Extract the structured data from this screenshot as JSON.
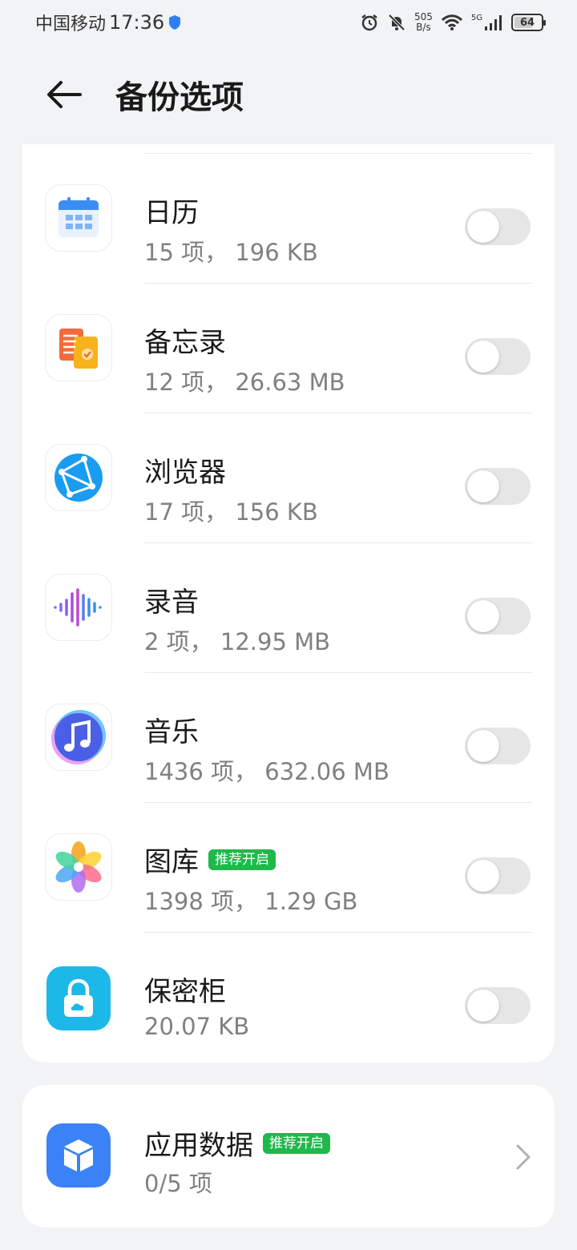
{
  "status_bar": {
    "carrier": "中国移动",
    "time": "17:36",
    "net_speed_value": "505",
    "net_speed_unit": "B/s",
    "network_type": "5G",
    "battery": "64"
  },
  "header": {
    "title": "备份选项"
  },
  "items": [
    {
      "name": "日历",
      "detail": "15 项， 196 KB",
      "enabled": false,
      "icon": "calendar-icon"
    },
    {
      "name": "备忘录",
      "detail": "12 项， 26.63 MB",
      "enabled": false,
      "icon": "notes-icon"
    },
    {
      "name": "浏览器",
      "detail": "17 项， 156 KB",
      "enabled": false,
      "icon": "browser-icon"
    },
    {
      "name": "录音",
      "detail": "2 项， 12.95 MB",
      "enabled": false,
      "icon": "recorder-icon"
    },
    {
      "name": "音乐",
      "detail": "1436 项， 632.06 MB",
      "enabled": false,
      "icon": "music-icon"
    },
    {
      "name": "图库",
      "badge": "推荐开启",
      "detail": "1398 项， 1.29 GB",
      "enabled": false,
      "icon": "gallery-icon"
    },
    {
      "name": "保密柜",
      "detail": "20.07 KB",
      "enabled": false,
      "icon": "safe-icon"
    }
  ],
  "app_data": {
    "name": "应用数据",
    "badge": "推荐开启",
    "detail": "0/5 项",
    "icon": "app-data-icon"
  },
  "colors": {
    "badge_green": "#1fb84a",
    "toggle_off": "#e6e6e6",
    "background": "#f1f3f5"
  }
}
